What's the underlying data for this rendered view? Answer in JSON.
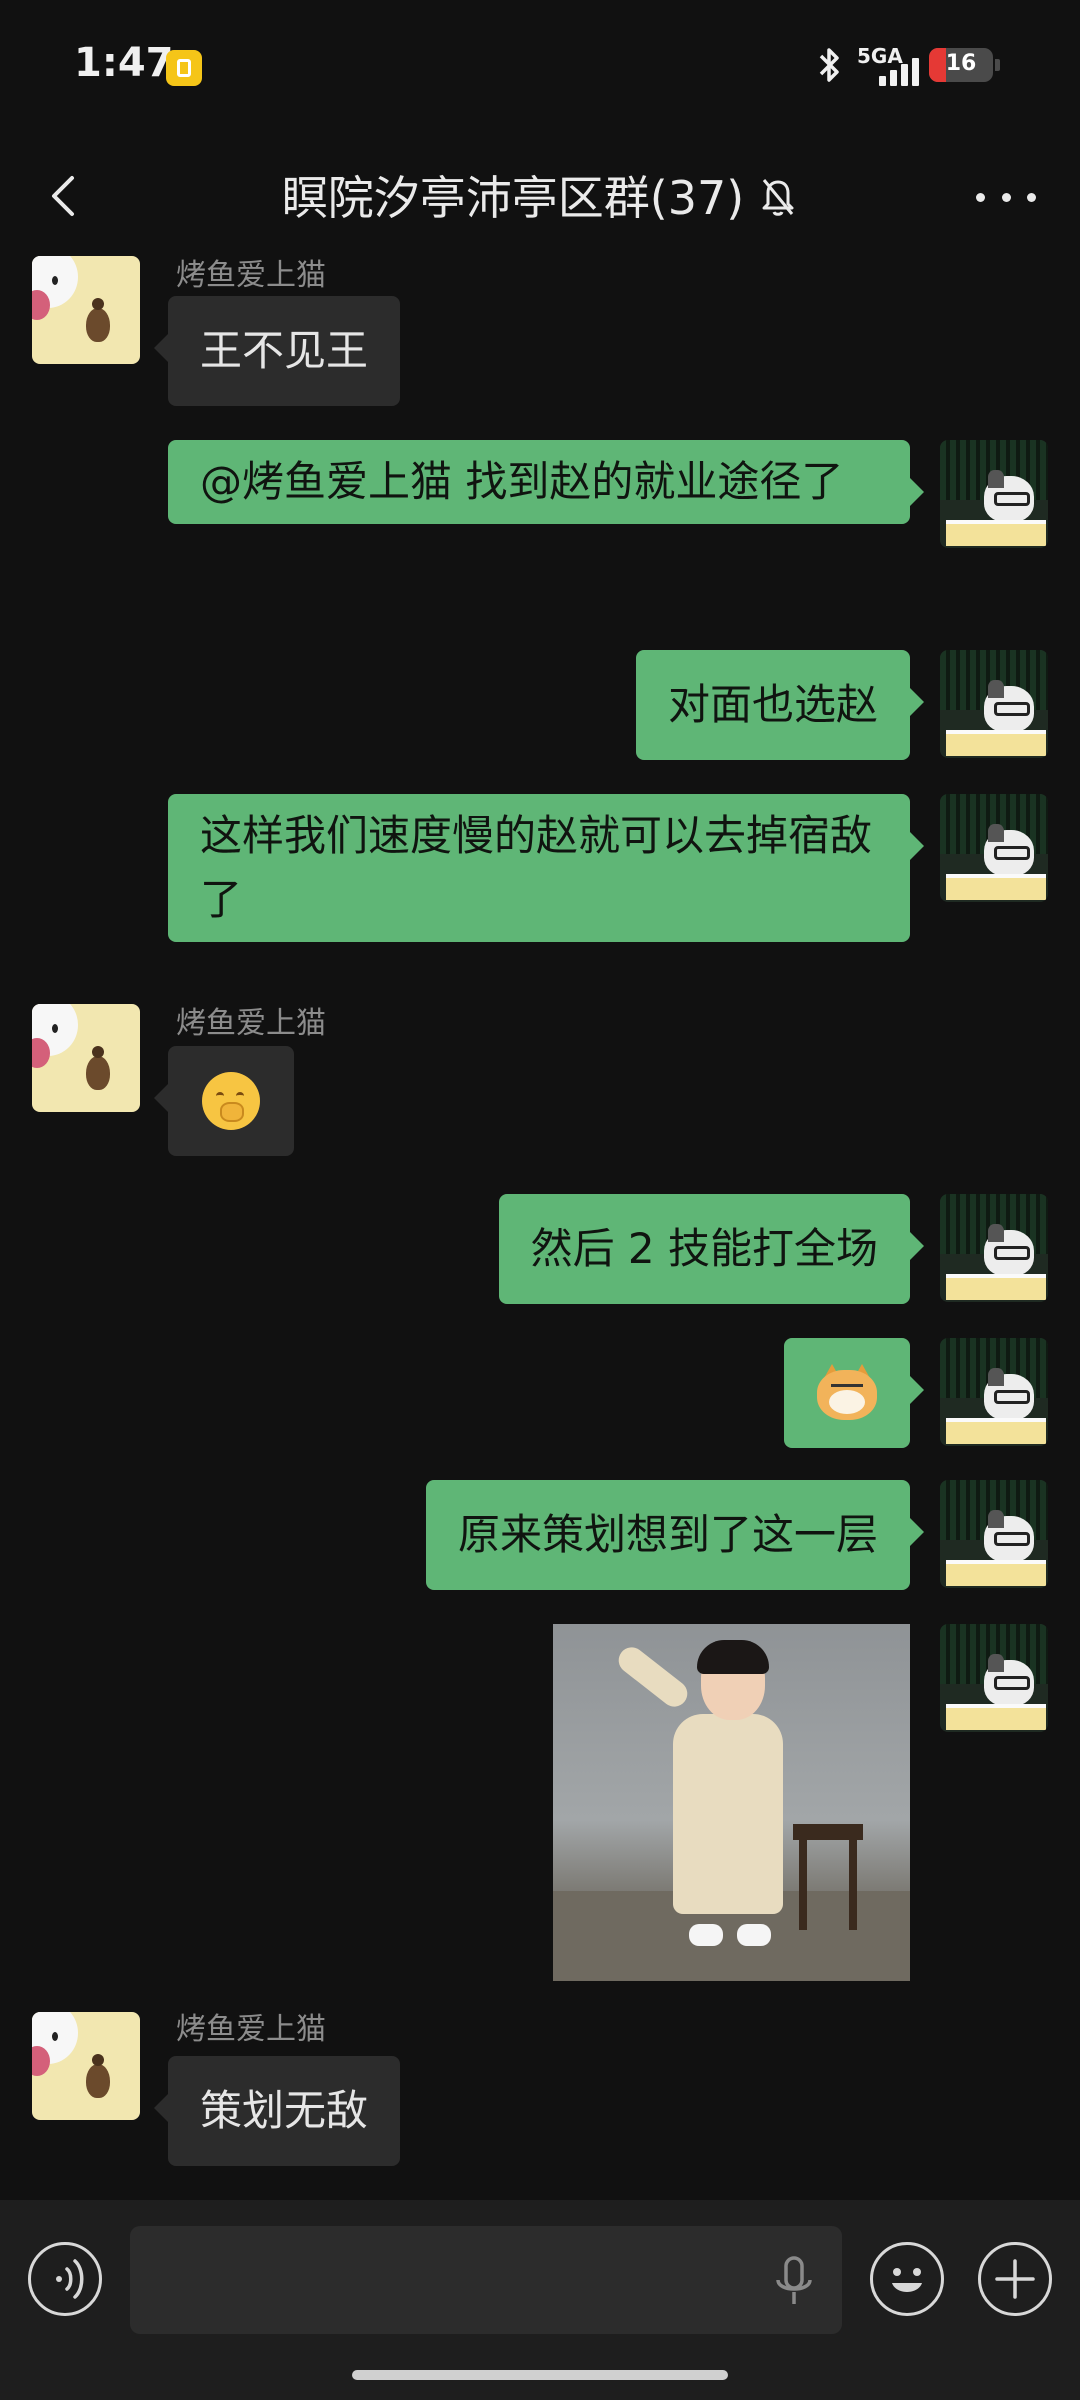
{
  "status_bar": {
    "time": "1:47",
    "network": "5GA",
    "battery": "16"
  },
  "header": {
    "title": "瞑院汐亭沛亭区群(37)"
  },
  "messages": [
    {
      "side": "left",
      "sender": "烤鱼爱上猫",
      "text": "王不见王"
    },
    {
      "side": "right",
      "text": "@烤鱼爱上猫  找到赵的就业途径了"
    },
    {
      "side": "right",
      "text": "对面也选赵"
    },
    {
      "side": "right",
      "text": "这样我们速度慢的赵就可以去掉宿敌了"
    },
    {
      "side": "left",
      "sender": "烤鱼爱上猫",
      "emoji": "shushing-face-emoji"
    },
    {
      "side": "right",
      "text": "然后 2 技能打全场"
    },
    {
      "side": "right",
      "emoji": "doge-emoji"
    },
    {
      "side": "right",
      "text": "原来策划想到了这一层"
    },
    {
      "side": "right",
      "image": "dancing-child-photo"
    },
    {
      "side": "left",
      "sender": "烤鱼爱上猫",
      "text": "策划无敌"
    }
  ],
  "input": {
    "value": ""
  },
  "colors": {
    "background": "#111111",
    "bubble_self": "#5fb676",
    "bubble_other": "#2c2c2c",
    "input_bar": "#1e1e1e",
    "battery_low": "#e53935"
  }
}
